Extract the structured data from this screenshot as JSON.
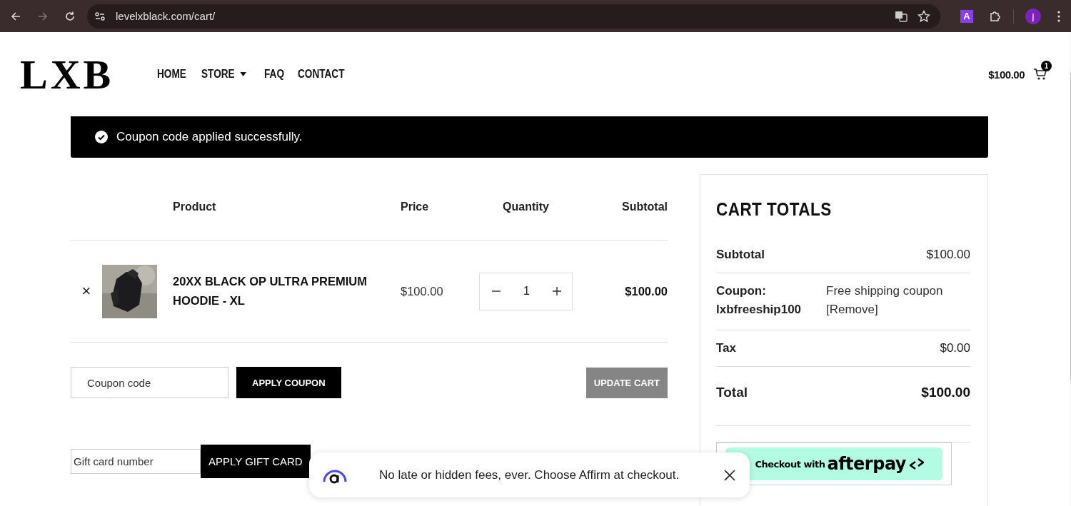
{
  "browser": {
    "url": "levelxblack.com/cart/",
    "forward_disabled": true,
    "extension_label": "A",
    "avatar_letter": "j"
  },
  "header": {
    "logo": "LXB",
    "nav": [
      {
        "label": "HOME",
        "dropdown": false
      },
      {
        "label": "STORE",
        "dropdown": true
      },
      {
        "label": "FAQ",
        "dropdown": false
      },
      {
        "label": "CONTACT",
        "dropdown": false
      }
    ],
    "cart_total": "$100.00",
    "cart_count": "1"
  },
  "notice": {
    "message": "Coupon code applied successfully."
  },
  "cart_table": {
    "columns": [
      "Product",
      "Price",
      "Quantity",
      "Subtotal"
    ],
    "rows": [
      {
        "remove": "×",
        "product": "20XX BLACK OP ULTRA PREMIUM HOODIE - XL",
        "price": "$100.00",
        "quantity": "1",
        "subtotal": "$100.00"
      }
    ]
  },
  "coupon": {
    "placeholder": "Coupon code",
    "apply_button": "APPLY COUPON",
    "update_button": "UPDATE CART",
    "update_disabled": true
  },
  "gift_card": {
    "placeholder": "Gift card number",
    "apply_button": "APPLY GIFT CARD"
  },
  "cart_totals": {
    "title": "CART TOTALS",
    "rows": [
      {
        "kind": "plain",
        "label": "Subtotal",
        "value": "$100.00"
      },
      {
        "kind": "coupon",
        "label": "Coupon: lxbfreeship100",
        "value": "Free shipping coupon",
        "link": "[Remove]"
      },
      {
        "kind": "plain",
        "label": "Tax",
        "value": "$0.00"
      },
      {
        "kind": "total",
        "label": "Total",
        "value": "$100.00"
      }
    ],
    "afterpay": {
      "prefix": "Checkout with",
      "brand": "afterpay"
    }
  },
  "affirm_popup": {
    "message": "No late or hidden fees, ever. Choose Affirm at checkout."
  }
}
